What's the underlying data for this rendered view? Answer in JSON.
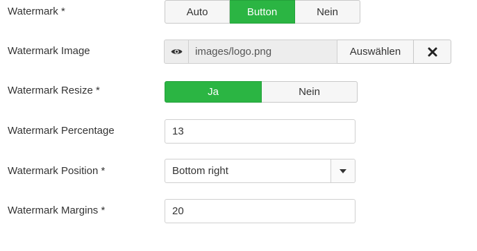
{
  "fields": {
    "watermark": {
      "label": "Watermark *",
      "options": [
        "Auto",
        "Button",
        "Nein"
      ],
      "selected": "Button"
    },
    "image": {
      "label": "Watermark Image",
      "value": "images/logo.png",
      "choose_label": "Auswählen",
      "preview_icon": "eye-icon",
      "clear_icon": "close-icon"
    },
    "resize": {
      "label": "Watermark Resize *",
      "options": [
        "Ja",
        "Nein"
      ],
      "selected": "Ja"
    },
    "percentage": {
      "label": "Watermark Percentage",
      "value": "13"
    },
    "position": {
      "label": "Watermark Position *",
      "value": "Bottom right"
    },
    "margins": {
      "label": "Watermark Margins *",
      "value": "20"
    }
  },
  "colors": {
    "active": "#2bb543",
    "border": "#c8c8c8",
    "readonly_bg": "#ededed"
  }
}
